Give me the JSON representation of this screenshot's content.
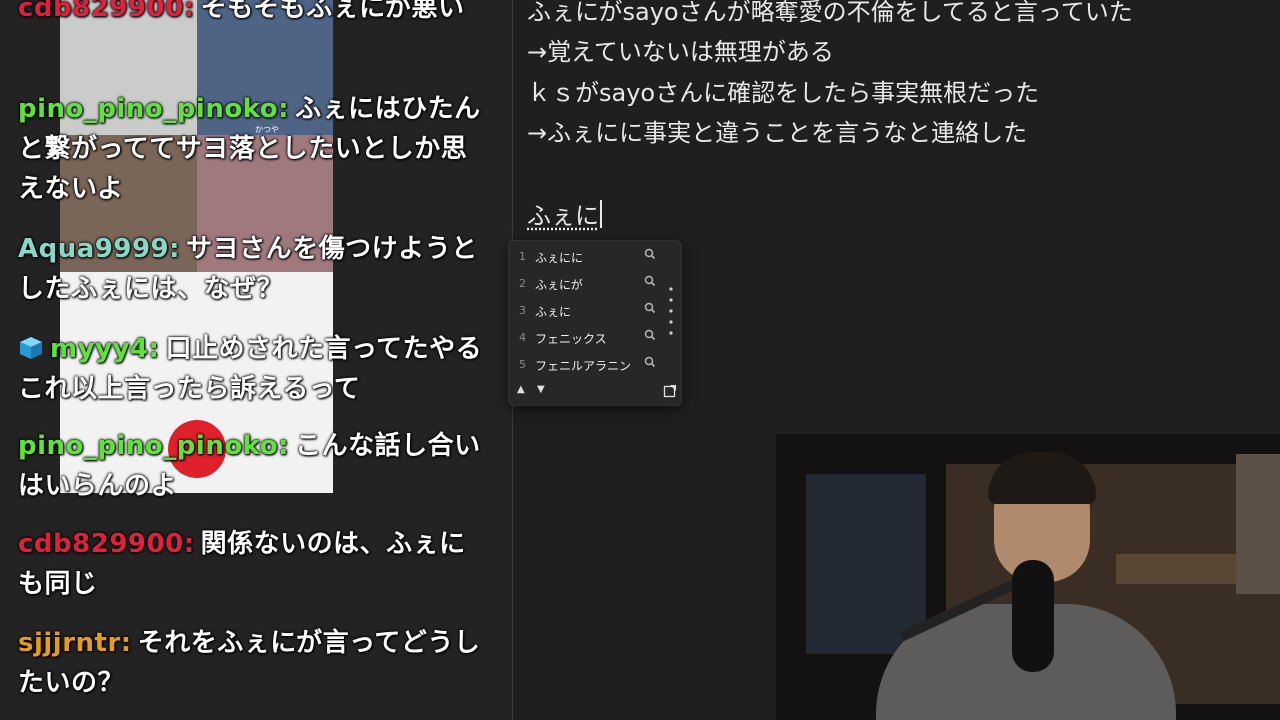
{
  "chat": {
    "overlay_caption": "かつや",
    "messages": [
      {
        "user": "cdb829900",
        "color": "#e0203c",
        "text": "そもそもふぇにが悪い"
      },
      {
        "user": "pino_pino_pinoko",
        "color": "#5fe33a",
        "text": "ふぇにはひたんと繋がっててサヨ落としたいとしか思えないよ"
      },
      {
        "user": "Aqua9999",
        "color": "#8ad7c8",
        "text": "サヨさんを傷つけようとしたふぇには、なぜ？"
      },
      {
        "user": "myyy4",
        "color": "#5fe33a",
        "icon": "cube-badge-icon",
        "text": "口止めされた言ってたやるこれ以上言ったら訴えるって"
      },
      {
        "user": "pino_pino_pinoko",
        "color": "#5fe33a",
        "text": "こんな話し合いはいらんのよ"
      },
      {
        "user": "cdb829900",
        "color": "#e0203c",
        "text": "関係ないのは、ふぇにも同じ"
      },
      {
        "user": "sjjjrntr",
        "color": "#e39b20",
        "text": "それをふぇにが言ってどうしたいの？"
      }
    ]
  },
  "editor": {
    "lines": [
      "ふぇにがsayoさんが略奪愛の不倫をしてると言っていた",
      "→覚えていないは無理がある",
      "ｋｓがsayoさんに確認をしたら事実無根だった",
      "→ふぇにに事実と違うことを言うなと連絡した"
    ],
    "composing": "ふぇに"
  },
  "ime": {
    "candidates": [
      {
        "num": "1",
        "text": "ふぇにに"
      },
      {
        "num": "2",
        "text": "ふぇにが"
      },
      {
        "num": "3",
        "text": "ふぇに"
      },
      {
        "num": "4",
        "text": "フェニックス"
      },
      {
        "num": "5",
        "text": "フェニルアラニン"
      }
    ],
    "prev_glyph": "▲",
    "next_glyph": "▼",
    "icons": {
      "search": "search-icon",
      "expand": "expand-icon",
      "more": "more-vertical-icon"
    }
  }
}
